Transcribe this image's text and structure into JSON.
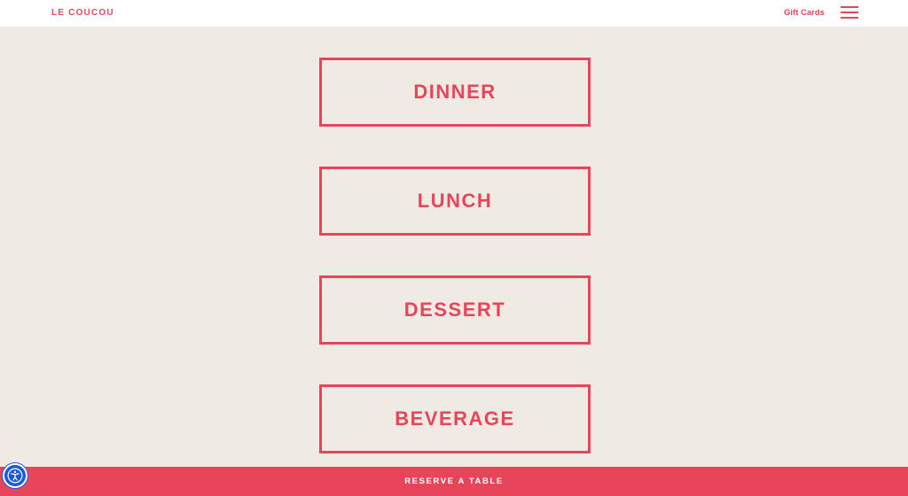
{
  "header": {
    "logo": "LE COUCOU",
    "gift_cards": "Gift Cards",
    "menu_icon": "hamburger-menu-icon"
  },
  "menu_buttons": [
    {
      "label": "DINNER"
    },
    {
      "label": "LUNCH"
    },
    {
      "label": "DESSERT"
    },
    {
      "label": "BEVERAGE"
    }
  ],
  "footer": {
    "reserve_label": "RESERVE A TABLE"
  },
  "accessibility": {
    "icon": "accessibility-person-icon"
  },
  "colors": {
    "accent": "#e8445a",
    "background": "#efebe3",
    "header_bg": "#ffffff",
    "accessibility_blue": "#1a5bdc"
  }
}
